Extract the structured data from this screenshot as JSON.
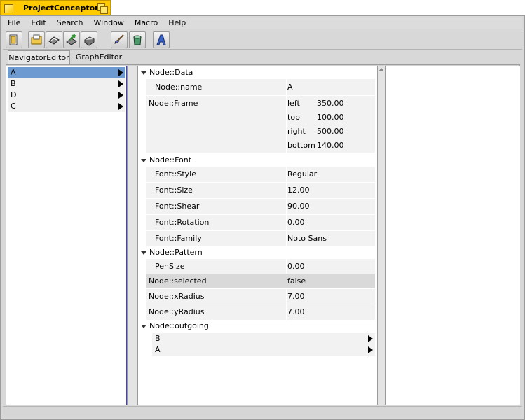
{
  "window": {
    "title": "ProjectConceptor"
  },
  "menu": [
    "File",
    "Edit",
    "Search",
    "Window",
    "Macro",
    "Help"
  ],
  "toolbar": {
    "icons": [
      "new-document-icon",
      "open-folder-icon",
      "save-icon",
      "export-icon",
      "print-icon",
      "brush-icon",
      "trash-icon",
      "text-style-icon"
    ]
  },
  "tabs": {
    "navigator": "NavigatorEditor",
    "graph": "GraphEditor"
  },
  "nav": {
    "items": [
      {
        "label": "A",
        "selected": true
      },
      {
        "label": "B",
        "selected": false
      },
      {
        "label": "D",
        "selected": false
      },
      {
        "label": "C",
        "selected": false
      }
    ]
  },
  "props": {
    "data": {
      "header": "Node::Data",
      "name_key": "Node::name",
      "name_val": "A",
      "frame_key": "Node::Frame",
      "frame": [
        {
          "k": "left",
          "v": "350.00"
        },
        {
          "k": "top",
          "v": "100.00"
        },
        {
          "k": "right",
          "v": "500.00"
        },
        {
          "k": "bottom",
          "v": "140.00"
        }
      ]
    },
    "font": {
      "header": "Node::Font",
      "rows": [
        {
          "k": "Font::Style",
          "v": "Regular"
        },
        {
          "k": "Font::Size",
          "v": "12.00"
        },
        {
          "k": "Font::Shear",
          "v": "90.00"
        },
        {
          "k": "Font::Rotation",
          "v": "0.00"
        },
        {
          "k": "Font::Family",
          "v": "Noto Sans"
        }
      ]
    },
    "pattern": {
      "header": "Node::Pattern",
      "pensize_key": "PenSize",
      "pensize_val": "0.00"
    },
    "misc": [
      {
        "k": "Node::selected",
        "v": "false"
      },
      {
        "k": "Node::xRadius",
        "v": "7.00"
      },
      {
        "k": "Node::yRadius",
        "v": "7.00"
      }
    ],
    "outgoing": {
      "header": "Node::outgoing",
      "items": [
        "B",
        "A"
      ]
    }
  }
}
